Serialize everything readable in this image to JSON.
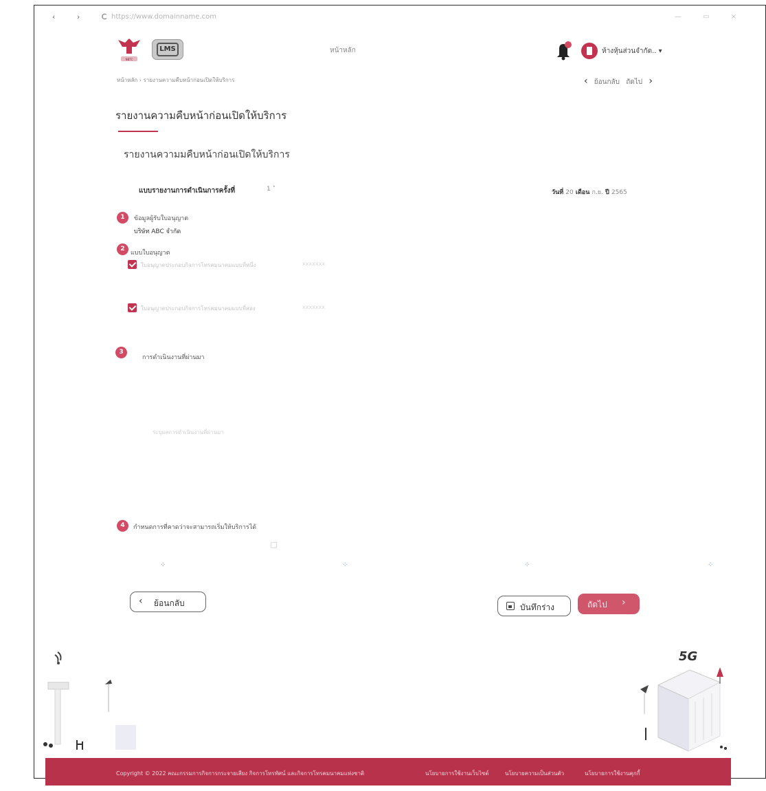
{
  "browser": {
    "nav_glyphs": "‹ › C",
    "url": "https://www.domainname.com",
    "window_controls": "— ▭ ×"
  },
  "header": {
    "logo_text": "LMS",
    "home_label": "หน้าหลัก",
    "notification_badge": "",
    "user_name": "ห้างหุ้นส่วนจำกัด..",
    "user_caret": "▾"
  },
  "breadcrumb": {
    "text": "หน้าหลัก  ›  รายงานความคืบหน้าก่อนเปิดให้บริการ"
  },
  "pager": {
    "back_label": "ย้อนกลับ",
    "next_label": "ถัดไป"
  },
  "page": {
    "title": "รายงานความคืบหน้าก่อนเปิดให้บริการ",
    "section_title": "รายงานความมคืบหน้าก่อนเปิดให้บริการ",
    "report_round_label": "แบบรายงานการดำเนินการครั้งที่",
    "report_round_value": "1 ˅",
    "date": {
      "day_label": "วันที่",
      "day": "20",
      "month_label": "เดือน",
      "month": "ก.ย.",
      "year_label": "ปี",
      "year": "2565"
    }
  },
  "steps": [
    {
      "number": "1",
      "label": "ข้อมูลผู้รับใบอนุญาต",
      "value": "บริษัท ABC จำกัด"
    },
    {
      "number": "2",
      "label": "แบบใบอนุญาต"
    },
    {
      "number": "3",
      "label": "การดำเนินงานที่ผ่านมา",
      "placeholder": "ระบุผลการดำเนินงานที่ผ่านมา"
    },
    {
      "number": "4",
      "label": "กำหนดการที่คาดว่าจะสามารถเริ่มให้บริการได้"
    }
  ],
  "license_items": [
    {
      "text": "ใบอนุญาตประกอบกิจการโทรคมนาคมแบบที่หนึ่ง",
      "code": "xxxxxxx"
    },
    {
      "text": "ใบอนุญาตประกอบกิจการโทรคมนาคมแบบที่สอง",
      "code": "xxxxxxx"
    }
  ],
  "actions": {
    "back": "ย้อนกลับ",
    "save_draft": "บันทึกร่าง",
    "next": "ถัดไป"
  },
  "footer": {
    "copyright": "Copyright © 2022 คณะกรรมการกิจการกระจายเสียง กิจการโทรทัศน์ และกิจการโทรคมนาคมแห่งชาติ",
    "links": [
      "นโยบายการใช้งานเว็บไซต์",
      "นโยบายความเป็นส่วนตัว",
      "นโยบายการใช้งานคุกกี้"
    ]
  },
  "colors": {
    "brand": "#c2334f",
    "footer": "#b8324c",
    "next_button": "#d0566c"
  },
  "icons": {
    "bell": "bell-icon",
    "save": "save-icon",
    "back": "chevron-left-icon",
    "next": "chevron-right-icon"
  }
}
